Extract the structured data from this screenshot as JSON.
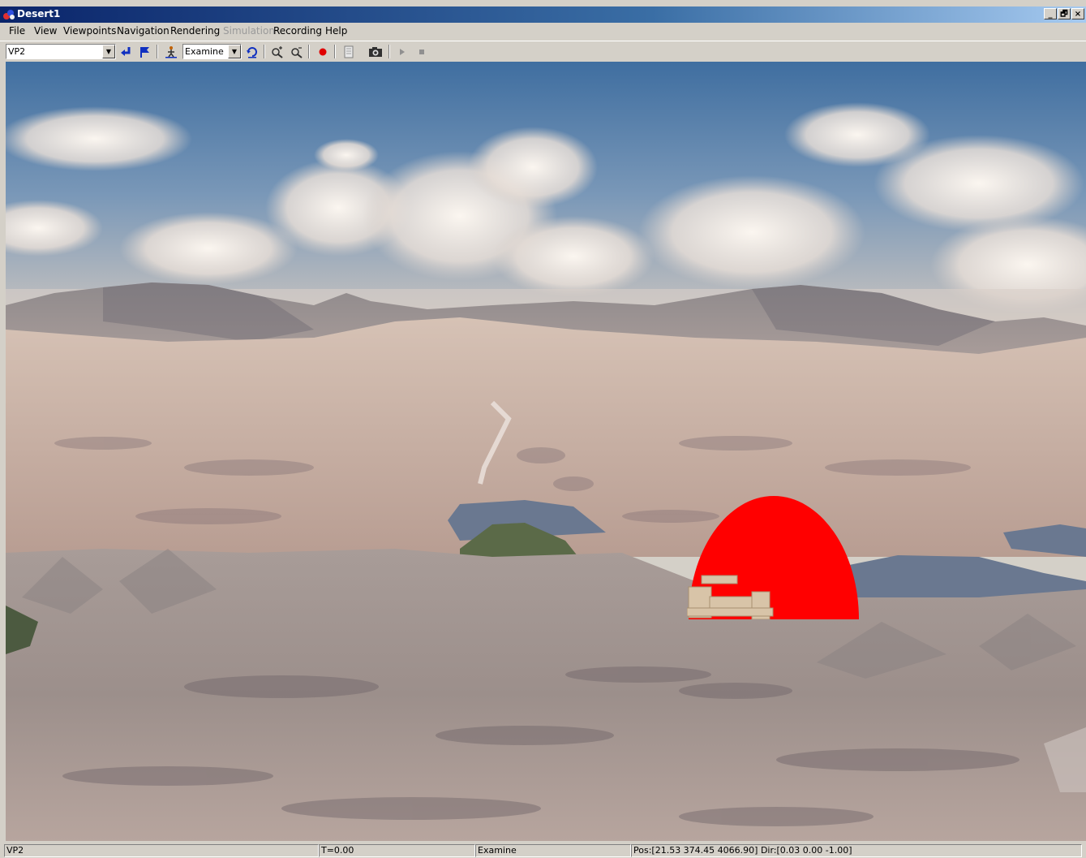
{
  "window": {
    "title": "Desert1",
    "minimize_label": "_",
    "restore_label": "🗗",
    "close_label": "×"
  },
  "menu": {
    "items": [
      {
        "label": "File",
        "enabled": true
      },
      {
        "label": "View",
        "enabled": true
      },
      {
        "label": "Viewpoints",
        "enabled": true
      },
      {
        "label": "Navigation",
        "enabled": true
      },
      {
        "label": "Rendering",
        "enabled": true
      },
      {
        "label": "Simulation",
        "enabled": false
      },
      {
        "label": "Recording",
        "enabled": true
      },
      {
        "label": "Help",
        "enabled": true
      }
    ]
  },
  "toolbar": {
    "viewpoint_select": "VP2",
    "navigation_mode_select": "Examine",
    "icons": [
      "return-arrow-icon",
      "flag-icon",
      "navigate-person-icon",
      "reset-view-icon",
      "zoom-in-icon",
      "zoom-out-icon",
      "record-icon",
      "document-icon",
      "camera-icon",
      "play-icon",
      "stop-icon"
    ]
  },
  "viewport": {
    "scene": "3d-desert-terrain",
    "marker_color": "#ff0000"
  },
  "status": {
    "viewpoint": "VP2",
    "time": "T=0.00",
    "mode": "Examine",
    "position": "Pos:[21.53 374.45 4066.90] Dir:[0.03 0.00 -1.00]"
  }
}
